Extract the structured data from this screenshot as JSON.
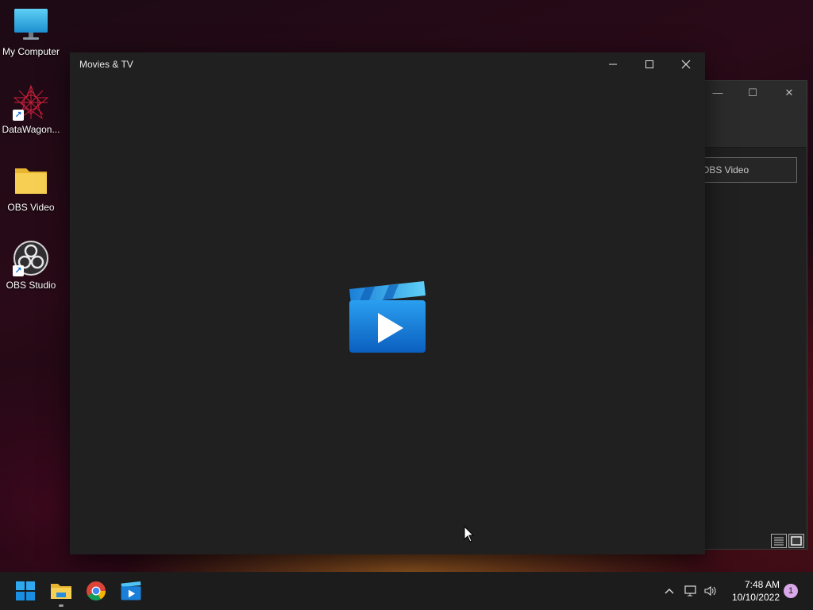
{
  "desktop": {
    "icons": [
      {
        "label": "My Computer",
        "icon": "monitor-icon"
      },
      {
        "label": "DataWagon...",
        "icon": "datawagon-icon"
      },
      {
        "label": "OBS Video",
        "icon": "folder-icon"
      },
      {
        "label": "OBS Studio",
        "icon": "obs-icon"
      }
    ]
  },
  "main_window": {
    "title": "Movies & TV",
    "app_icon": "movies-tv-icon"
  },
  "background_window": {
    "address_text": "OBS Video"
  },
  "taskbar": {
    "apps": [
      "start-icon",
      "file-explorer-icon",
      "chrome-icon",
      "movies-tv-icon"
    ],
    "clock_time": "7:48 AM",
    "clock_date": "10/10/2022",
    "notification_count": "1"
  },
  "colors": {
    "window_bg": "#202020",
    "taskbar_bg": "#1c1c1c",
    "accent_blue": "#1a7fd8"
  }
}
